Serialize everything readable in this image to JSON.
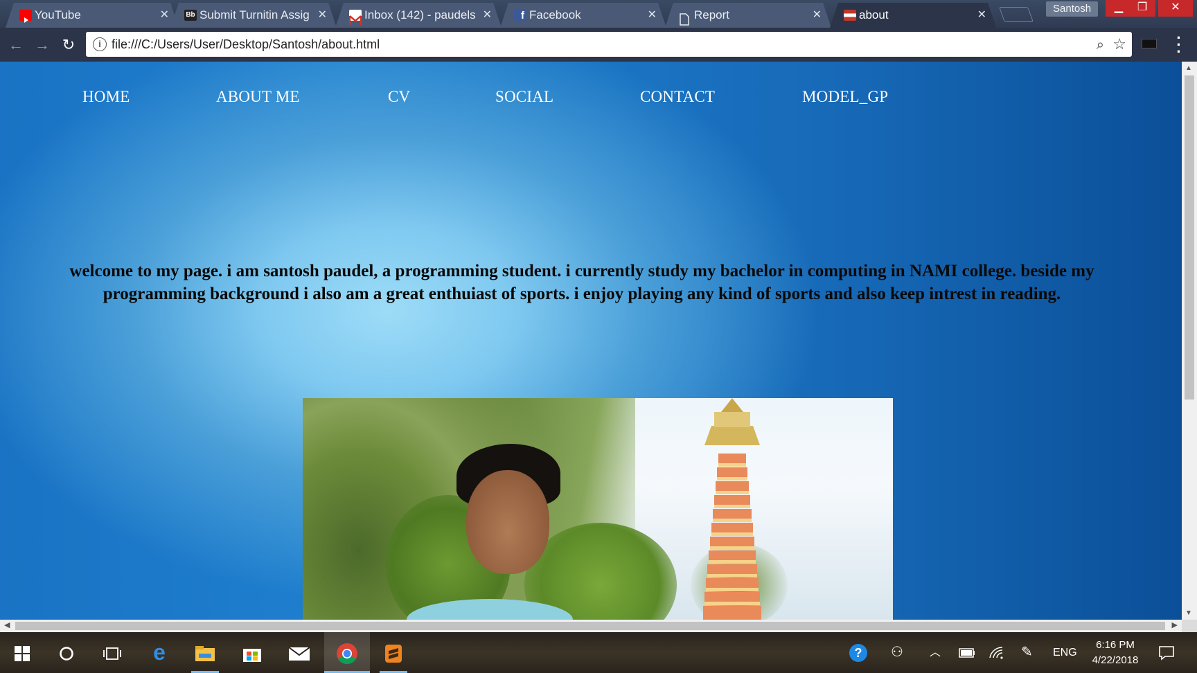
{
  "browser": {
    "tabs": [
      {
        "title": "YouTube",
        "icon": "youtube-icon",
        "color": "#ff0000"
      },
      {
        "title": "Submit Turnitin Assig",
        "icon": "blackboard-icon",
        "color": "#222222"
      },
      {
        "title": "Inbox (142) - paudels",
        "icon": "gmail-icon",
        "color": "#d93025"
      },
      {
        "title": "Facebook",
        "icon": "facebook-icon",
        "color": "#3b5998"
      },
      {
        "title": "Report",
        "icon": "document-icon",
        "color": "#ffffff"
      },
      {
        "title": "about",
        "icon": "page-icon",
        "color": "#c0392b",
        "active": true
      }
    ],
    "profile_name": "Santosh",
    "address": "file:///C:/Users/User/Desktop/Santosh/about.html"
  },
  "page": {
    "nav": [
      "HOME",
      "ABOUT ME",
      "CV",
      "SOCIAL",
      "CONTACT",
      "MODEL_GP"
    ],
    "intro": "welcome to my page. i am santosh paudel, a programming student. i currently study my bachelor in computing in NAMI college. beside my programming background i also am a great enthuiast of sports. i enjoy playing any kind of sports and also keep intrest in reading."
  },
  "taskbar": {
    "apps": [
      "windows-start-icon",
      "cortana-icon",
      "task-view-icon",
      "edge-icon",
      "file-explorer-icon",
      "store-icon",
      "mail-icon",
      "chrome-icon",
      "sublime-icon"
    ],
    "active_app": "chrome-icon",
    "language": "ENG",
    "time": "6:16 PM",
    "date": "4/22/2018"
  }
}
